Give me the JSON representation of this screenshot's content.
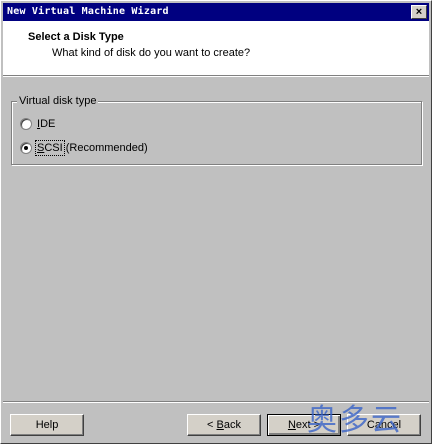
{
  "window": {
    "title": "New Virtual Machine Wizard",
    "close_glyph": "×"
  },
  "header": {
    "title": "Select a Disk Type",
    "subtitle": "What kind of disk do you want to create?"
  },
  "disk_type": {
    "legend": "Virtual disk type",
    "options": [
      {
        "mnemonic": "I",
        "rest": "DE",
        "suffix": "",
        "selected": false
      },
      {
        "mnemonic": "S",
        "rest": "CSI",
        "suffix": " (Recommended)",
        "selected": true
      }
    ]
  },
  "buttons": {
    "help": "Help",
    "back_mnemonic": "B",
    "back_prefix": "< ",
    "back_rest": "ack",
    "next_prefix": "",
    "next_mnemonic": "N",
    "next_rest": "ext >",
    "cancel": "Cancel"
  },
  "watermark": "奥多云"
}
